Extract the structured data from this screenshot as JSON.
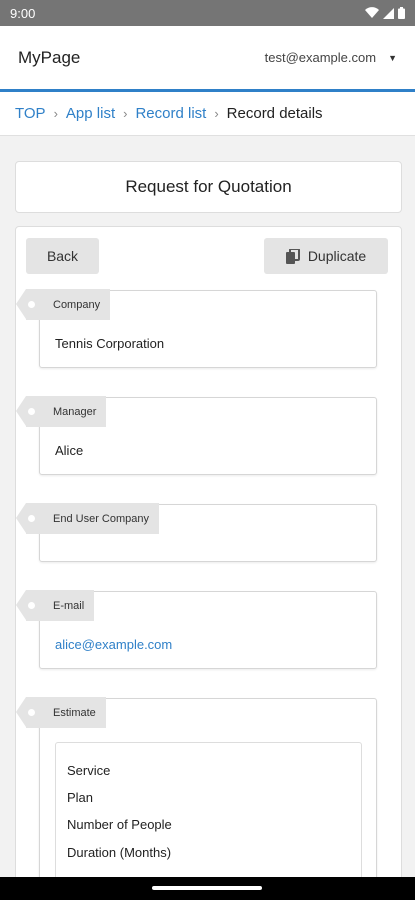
{
  "status_bar": {
    "time": "9:00"
  },
  "header": {
    "app_title": "MyPage",
    "user_email": "test@example.com",
    "menu_caret": "▼"
  },
  "breadcrumb": {
    "items": [
      "TOP",
      "App list",
      "Record list"
    ],
    "current": "Record details",
    "separator": "›"
  },
  "page": {
    "title": "Request for Quotation"
  },
  "actions": {
    "back_label": "Back",
    "duplicate_label": "Duplicate"
  },
  "fields": {
    "company": {
      "label": "Company",
      "value": "Tennis Corporation"
    },
    "manager": {
      "label": "Manager",
      "value": "Alice"
    },
    "end_user_company": {
      "label": "End User Company",
      "value": ""
    },
    "email": {
      "label": "E-mail",
      "value": "alice@example.com"
    },
    "estimate": {
      "label": "Estimate",
      "rows": [
        "Service",
        "Plan",
        "Number of People",
        "Duration (Months)"
      ]
    }
  },
  "colors": {
    "accent": "#2f80c8",
    "status_bar": "#757575",
    "label_bg": "#e4e4e4"
  },
  "icons": {
    "wifi": "wifi-icon",
    "signal": "signal-icon",
    "battery": "battery-icon",
    "duplicate": "copy-icon"
  }
}
